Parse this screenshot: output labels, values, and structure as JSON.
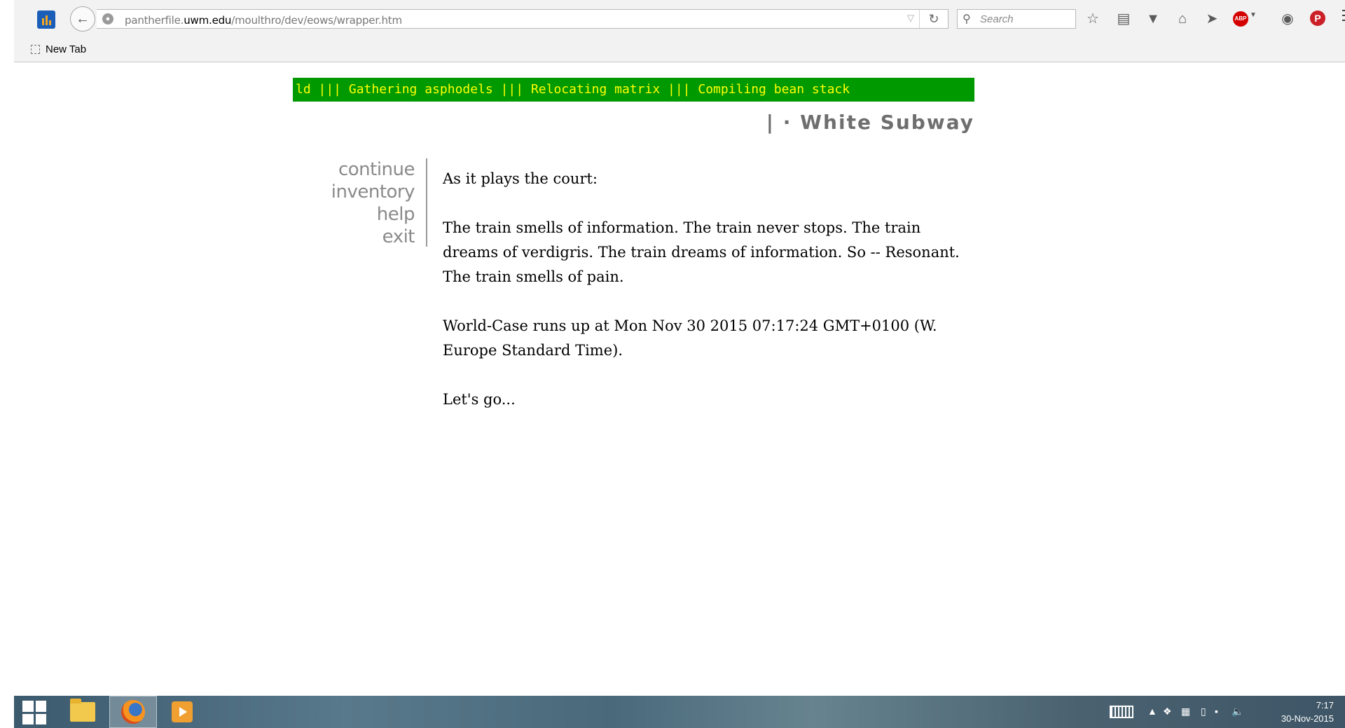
{
  "browser": {
    "url_prefix": "pantherfile.",
    "url_domain": "uwm.edu",
    "url_path": "/moulthro/dev/eows/wrapper.htm",
    "search_placeholder": "Search",
    "bookmark_label": "New Tab",
    "abp_label": "ABP"
  },
  "page": {
    "marquee_text": "ld ||| Gathering asphodels ||| Relocating matrix ||| Compiling bean stack",
    "title": "| · White Subway",
    "nav": [
      "continue",
      "inventory",
      "help",
      "exit"
    ],
    "paragraphs": [
      "As it plays the court:",
      "The train smells of information. The train never stops. The train dreams of verdigris. The train dreams of information. So -- Resonant. The train smells of pain.",
      "World-Case runs up at Mon Nov 30 2015 07:17:24 GMT+0100 (W. Europe Standard Time).",
      "Let's go..."
    ],
    "marquee_bg": "#009900",
    "marquee_fg": "#ffff00"
  },
  "taskbar": {
    "time": "7:17",
    "date": "30-Nov-2015"
  }
}
